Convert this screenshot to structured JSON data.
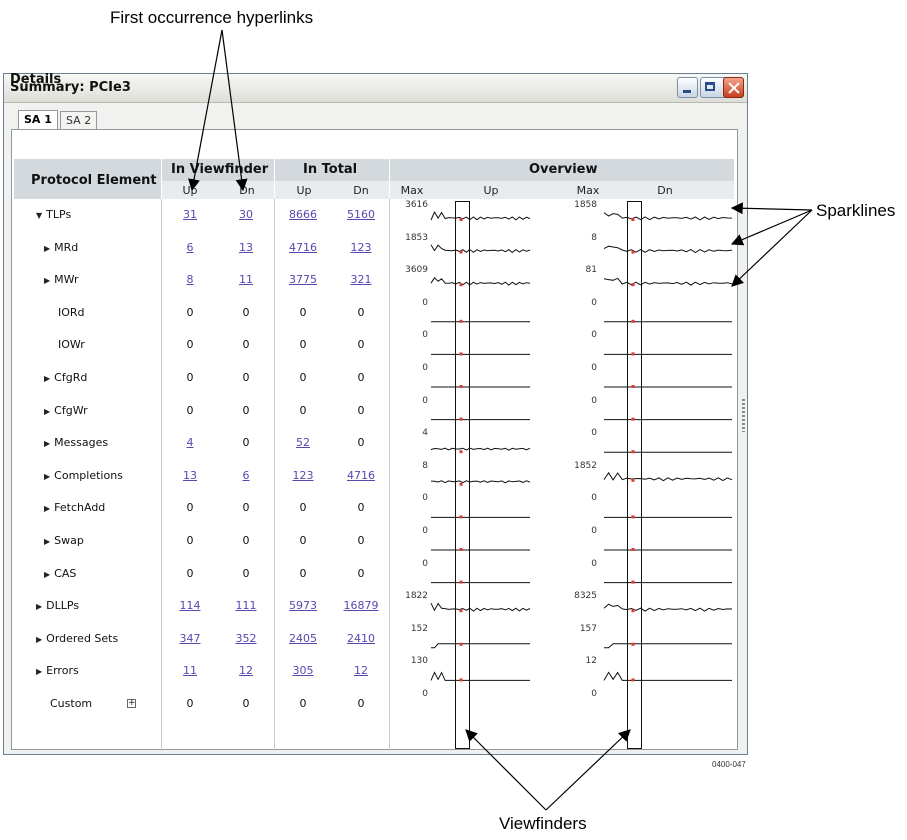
{
  "annotations": {
    "first_occurrence": "First occurrence hyperlinks",
    "sparklines": "Sparklines",
    "viewfinders": "Viewfinders",
    "figure_number": "0400-047"
  },
  "window": {
    "title": "Summary: PCIe3"
  },
  "tabs": [
    {
      "label": "SA 1",
      "active": true
    },
    {
      "label": "SA 2",
      "active": false
    }
  ],
  "details_label": "Details",
  "headers": {
    "protocol_element": "Protocol Element",
    "in_viewfinder": "In Viewfinder",
    "in_total": "In Total",
    "overview": "Overview",
    "up": "Up",
    "dn": "Dn",
    "max": "Max"
  },
  "rows": [
    {
      "name": "TLPs",
      "expander": "expanded",
      "vf_up": "31",
      "vf_dn": "30",
      "total_up": "8666",
      "total_dn": "5160",
      "max_up": "3616",
      "max_dn": "1858",
      "spark_up": "active",
      "spark_dn": "active"
    },
    {
      "name": "MRd",
      "expander": "collapsed",
      "vf_up": "6",
      "vf_dn": "13",
      "total_up": "4716",
      "total_dn": "123",
      "max_up": "1853",
      "max_dn": "8",
      "spark_up": "active",
      "spark_dn": "active"
    },
    {
      "name": "MWr",
      "expander": "collapsed",
      "vf_up": "8",
      "vf_dn": "11",
      "total_up": "3775",
      "total_dn": "321",
      "max_up": "3609",
      "max_dn": "81",
      "spark_up": "active",
      "spark_dn": "active"
    },
    {
      "name": "IORd",
      "expander": "none",
      "vf_up": "0",
      "vf_dn": "0",
      "total_up": "0",
      "total_dn": "0",
      "max_up": "0",
      "max_dn": "0",
      "spark_up": "flat",
      "spark_dn": "flat"
    },
    {
      "name": "IOWr",
      "expander": "none",
      "vf_up": "0",
      "vf_dn": "0",
      "total_up": "0",
      "total_dn": "0",
      "max_up": "0",
      "max_dn": "0",
      "spark_up": "flat",
      "spark_dn": "flat"
    },
    {
      "name": "CfgRd",
      "expander": "collapsed",
      "vf_up": "0",
      "vf_dn": "0",
      "total_up": "0",
      "total_dn": "0",
      "max_up": "0",
      "max_dn": "0",
      "spark_up": "flat",
      "spark_dn": "flat"
    },
    {
      "name": "CfgWr",
      "expander": "collapsed",
      "vf_up": "0",
      "vf_dn": "0",
      "total_up": "0",
      "total_dn": "0",
      "max_up": "0",
      "max_dn": "0",
      "spark_up": "flat",
      "spark_dn": "flat"
    },
    {
      "name": "Messages",
      "expander": "collapsed",
      "vf_up": "4",
      "vf_dn": "0",
      "total_up": "52",
      "total_dn": "0",
      "max_up": "4",
      "max_dn": "0",
      "spark_up": "low",
      "spark_dn": "flat"
    },
    {
      "name": "Completions",
      "expander": "collapsed",
      "vf_up": "13",
      "vf_dn": "6",
      "total_up": "123",
      "total_dn": "4716",
      "max_up": "8",
      "max_dn": "1852",
      "spark_up": "low",
      "spark_dn": "active"
    },
    {
      "name": "FetchAdd",
      "expander": "collapsed",
      "vf_up": "0",
      "vf_dn": "0",
      "total_up": "0",
      "total_dn": "0",
      "max_up": "0",
      "max_dn": "0",
      "spark_up": "flat",
      "spark_dn": "flat"
    },
    {
      "name": "Swap",
      "expander": "collapsed",
      "vf_up": "0",
      "vf_dn": "0",
      "total_up": "0",
      "total_dn": "0",
      "max_up": "0",
      "max_dn": "0",
      "spark_up": "flat",
      "spark_dn": "flat"
    },
    {
      "name": "CAS",
      "expander": "collapsed",
      "vf_up": "0",
      "vf_dn": "0",
      "total_up": "0",
      "total_dn": "0",
      "max_up": "0",
      "max_dn": "0",
      "spark_up": "flat",
      "spark_dn": "flat"
    },
    {
      "name": "DLLPs",
      "expander": "collapsed",
      "vf_up": "114",
      "vf_dn": "111",
      "total_up": "5973",
      "total_dn": "16879",
      "max_up": "1822",
      "max_dn": "8325",
      "spark_up": "active",
      "spark_dn": "active"
    },
    {
      "name": "Ordered Sets",
      "expander": "collapsed",
      "vf_up": "347",
      "vf_dn": "352",
      "total_up": "2405",
      "total_dn": "2410",
      "max_up": "152",
      "max_dn": "157",
      "spark_up": "step",
      "spark_dn": "step"
    },
    {
      "name": "Errors",
      "expander": "collapsed",
      "vf_up": "11",
      "vf_dn": "12",
      "total_up": "305",
      "total_dn": "12",
      "max_up": "130",
      "max_dn": "12",
      "spark_up": "spike",
      "spark_dn": "spike"
    },
    {
      "name": "Custom",
      "expander": "plus",
      "vf_up": "0",
      "vf_dn": "0",
      "total_up": "0",
      "total_dn": "0",
      "max_up": "0",
      "max_dn": "0",
      "spark_up": "empty",
      "spark_dn": "empty"
    }
  ],
  "colors": {
    "link": "#5b46b0",
    "marker": "#e03a2a",
    "header_bg": "#d3d9dd"
  }
}
